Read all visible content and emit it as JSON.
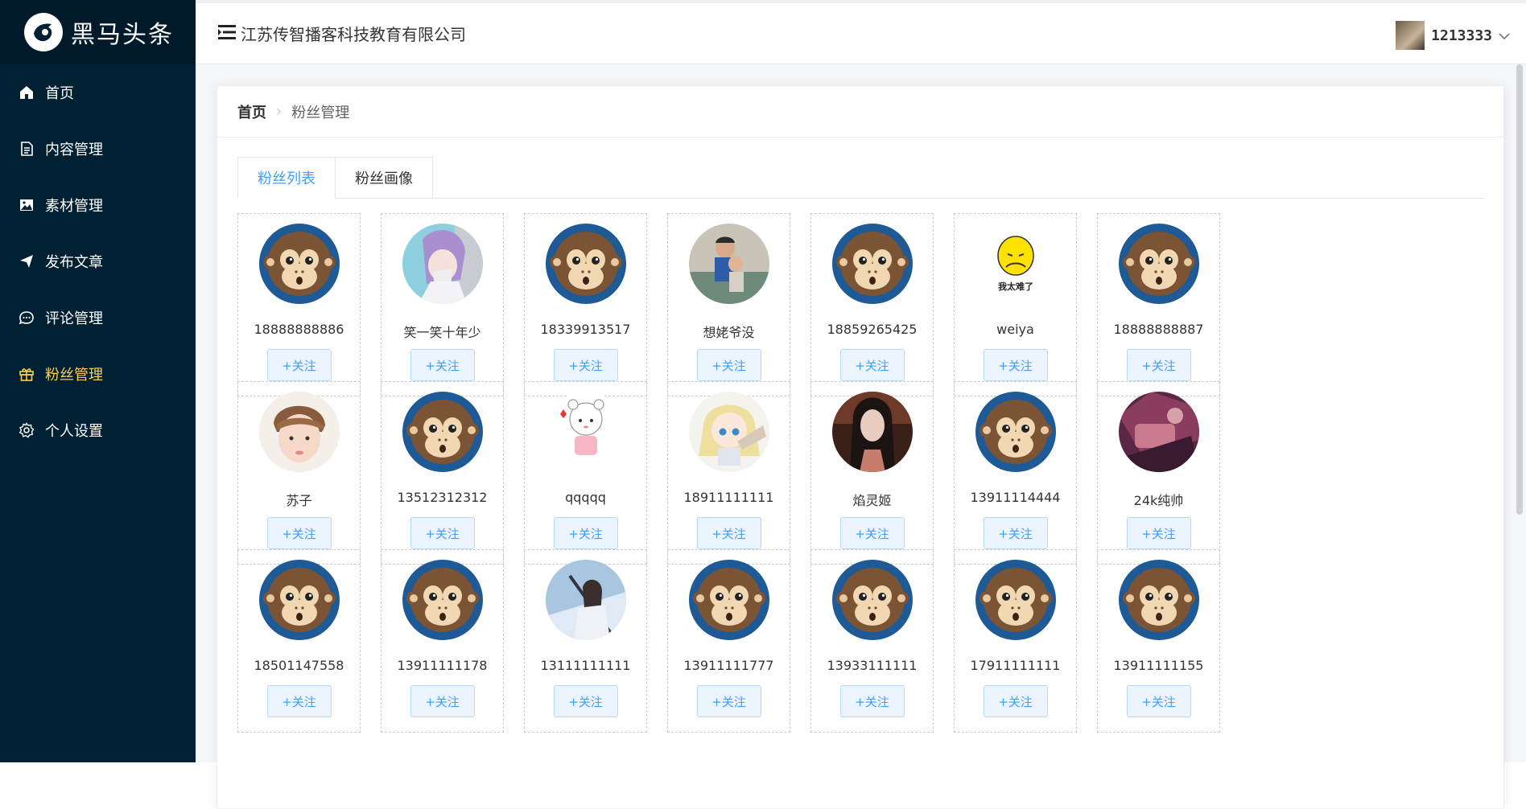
{
  "app": {
    "logo_text": "黑马头条"
  },
  "sidebar": {
    "items": [
      {
        "label": "首页",
        "icon": "home-icon"
      },
      {
        "label": "内容管理",
        "icon": "document-icon"
      },
      {
        "label": "素材管理",
        "icon": "picture-icon"
      },
      {
        "label": "发布文章",
        "icon": "send-icon"
      },
      {
        "label": "评论管理",
        "icon": "comment-icon"
      },
      {
        "label": "粉丝管理",
        "icon": "gift-icon",
        "active": true
      },
      {
        "label": "个人设置",
        "icon": "gear-icon"
      }
    ]
  },
  "header": {
    "company": "江苏传智播客科技教育有限公司",
    "user_name": "1213333"
  },
  "breadcrumb": {
    "home": "首页",
    "current": "粉丝管理"
  },
  "tabs": [
    {
      "label": "粉丝列表",
      "active": true
    },
    {
      "label": "粉丝画像",
      "active": false
    }
  ],
  "follow_label": "+关注",
  "fans": [
    {
      "name": "18888888886",
      "avatar": "monkey"
    },
    {
      "name": "笑一笑十年少",
      "avatar": "anime-purple"
    },
    {
      "name": "18339913517",
      "avatar": "monkey"
    },
    {
      "name": "想姥爷没",
      "avatar": "photo-kid"
    },
    {
      "name": "18859265425",
      "avatar": "monkey"
    },
    {
      "name": "weiya",
      "avatar": "yellow-emoji"
    },
    {
      "name": "18888888887",
      "avatar": "monkey"
    },
    {
      "name": "苏子",
      "avatar": "photo-boy"
    },
    {
      "name": "13512312312",
      "avatar": "monkey"
    },
    {
      "name": "qqqqq",
      "avatar": "cartoon-girl"
    },
    {
      "name": "18911111111",
      "avatar": "anime-blonde"
    },
    {
      "name": "焰灵姬",
      "avatar": "photo-dark"
    },
    {
      "name": "13911114444",
      "avatar": "monkey"
    },
    {
      "name": "24k纯帅",
      "avatar": "photo-purple"
    },
    {
      "name": "18501147558",
      "avatar": "monkey"
    },
    {
      "name": "13911111178",
      "avatar": "monkey"
    },
    {
      "name": "13111111111",
      "avatar": "anime-sword"
    },
    {
      "name": "13911111777",
      "avatar": "monkey"
    },
    {
      "name": "13933111111",
      "avatar": "monkey"
    },
    {
      "name": "17911111111",
      "avatar": "monkey"
    },
    {
      "name": "13911111155",
      "avatar": "monkey"
    }
  ],
  "colors": {
    "sidebar_bg": "#002033",
    "active_menu": "#ffd04b",
    "primary": "#409eff"
  }
}
